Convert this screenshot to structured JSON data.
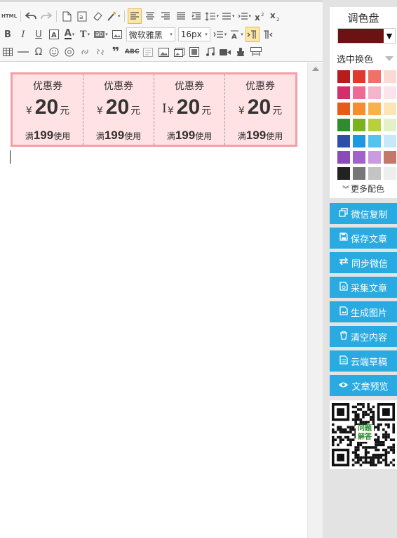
{
  "toolbar": {
    "html_label": "HTML",
    "font_family": "微软雅黑",
    "font_size": "16px",
    "strikeout_label": "ABC"
  },
  "coupons": [
    {
      "title": "优惠券",
      "yen": "¥",
      "value": "20",
      "unit": "元",
      "cond_prefix": "满",
      "cond_num": "199",
      "cond_suffix": "使用"
    },
    {
      "title": "优惠券",
      "yen": "¥",
      "value": "20",
      "unit": "元",
      "cond_prefix": "满",
      "cond_num": "199",
      "cond_suffix": "使用"
    },
    {
      "title": "优惠券",
      "yen": "¥",
      "value": "20",
      "unit": "元",
      "cond_prefix": "满",
      "cond_num": "199",
      "cond_suffix": "使用"
    },
    {
      "title": "优惠券",
      "yen": "¥",
      "value": "20",
      "unit": "元",
      "cond_prefix": "满",
      "cond_num": "199",
      "cond_suffix": "使用"
    }
  ],
  "palette": {
    "title": "调色盘",
    "current_color": "#6b1212",
    "select_change": "选中换色",
    "more_colors": "更多配色",
    "swatches": [
      "#b71c1c",
      "#e03a2f",
      "#f07166",
      "#fbdad6",
      "#d32f6b",
      "#ee6a96",
      "#f6b4cc",
      "#fde3ec",
      "#e8591a",
      "#f68d2e",
      "#f8b24a",
      "#fde6b3",
      "#2e8b2e",
      "#7ab31e",
      "#b8d03b",
      "#e4f0c8",
      "#2e4ea8",
      "#1e98e0",
      "#55c3f0",
      "#c6e8f9",
      "#8a4ab8",
      "#a262cc",
      "#c99be0",
      "#c4786a",
      "#222222",
      "#777777",
      "#c4c4c4",
      "#eeeeee"
    ]
  },
  "actions": [
    {
      "label": "微信复制",
      "icon": "copy-icon"
    },
    {
      "label": "保存文章",
      "icon": "save-icon"
    },
    {
      "label": "同步微信",
      "icon": "sync-icon"
    },
    {
      "label": "采集文章",
      "icon": "collect-icon"
    },
    {
      "label": "生成图片",
      "icon": "image-icon"
    },
    {
      "label": "清空内容",
      "icon": "trash-icon"
    },
    {
      "label": "云端草稿",
      "icon": "draft-icon"
    },
    {
      "label": "文章预览",
      "icon": "eye-icon"
    }
  ],
  "qr": {
    "label_line1": "问题",
    "label_line2": "解答"
  }
}
